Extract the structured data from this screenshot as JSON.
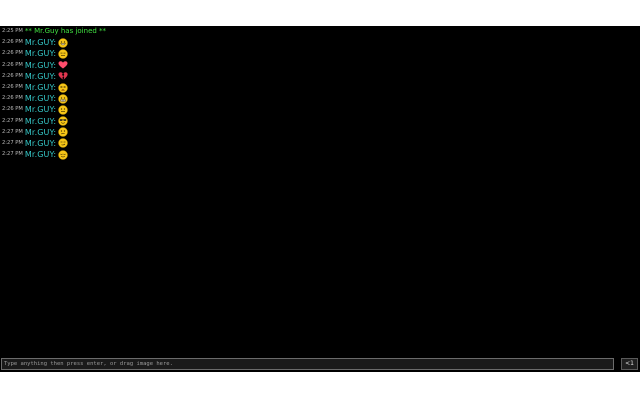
{
  "chat": {
    "join": {
      "time": "2:25 PM",
      "text": "** Mr.Guy has joined **"
    },
    "messages": [
      {
        "time": "2:26 PM",
        "user": "Mr.GUY:",
        "emoji": "grinning-face-icon"
      },
      {
        "time": "2:26 PM",
        "user": "Mr.GUY:",
        "emoji": "expressionless-face-icon"
      },
      {
        "time": "2:26 PM",
        "user": "Mr.GUY:",
        "emoji": "red-heart-icon"
      },
      {
        "time": "2:26 PM",
        "user": "Mr.GUY:",
        "emoji": "broken-heart-icon"
      },
      {
        "time": "2:26 PM",
        "user": "Mr.GUY:",
        "emoji": "tired-face-icon"
      },
      {
        "time": "2:26 PM",
        "user": "Mr.GUY:",
        "emoji": "grimacing-face-icon"
      },
      {
        "time": "2:26 PM",
        "user": "Mr.GUY:",
        "emoji": "neutral-face-icon"
      },
      {
        "time": "2:27 PM",
        "user": "Mr.GUY:",
        "emoji": "sunglasses-face-icon"
      },
      {
        "time": "2:27 PM",
        "user": "Mr.GUY:",
        "emoji": "confused-face-icon"
      },
      {
        "time": "2:27 PM",
        "user": "Mr.GUY:",
        "emoji": "smirking-face-icon"
      },
      {
        "time": "2:27 PM",
        "user": "Mr.GUY:",
        "emoji": "relieved-face-icon"
      }
    ]
  },
  "input": {
    "placeholder": "Type anything then press enter, or drag image here."
  },
  "send_button": {
    "label": "<1"
  },
  "colors": {
    "background": "#000000",
    "username": "#35c6c6",
    "join_text": "#41e241",
    "timestamp": "#b9b9b9"
  }
}
